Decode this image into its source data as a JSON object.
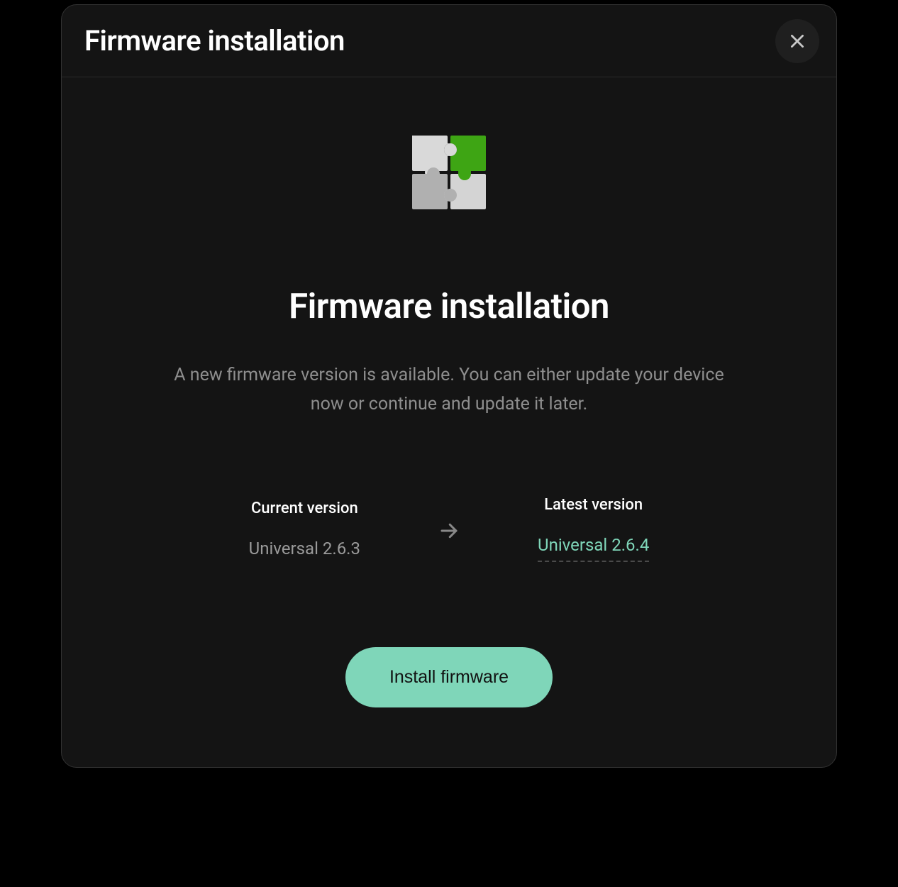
{
  "header": {
    "title": "Firmware installation"
  },
  "main": {
    "title": "Firmware installation",
    "subtext": "A new firmware version is available. You can either update your device now or continue and update it later.",
    "current_label": "Current version",
    "current_value": "Universal 2.6.3",
    "latest_label": "Latest version",
    "latest_value": "Universal 2.6.4",
    "install_label": "Install firmware"
  },
  "colors": {
    "accent": "#7fd6b9"
  }
}
